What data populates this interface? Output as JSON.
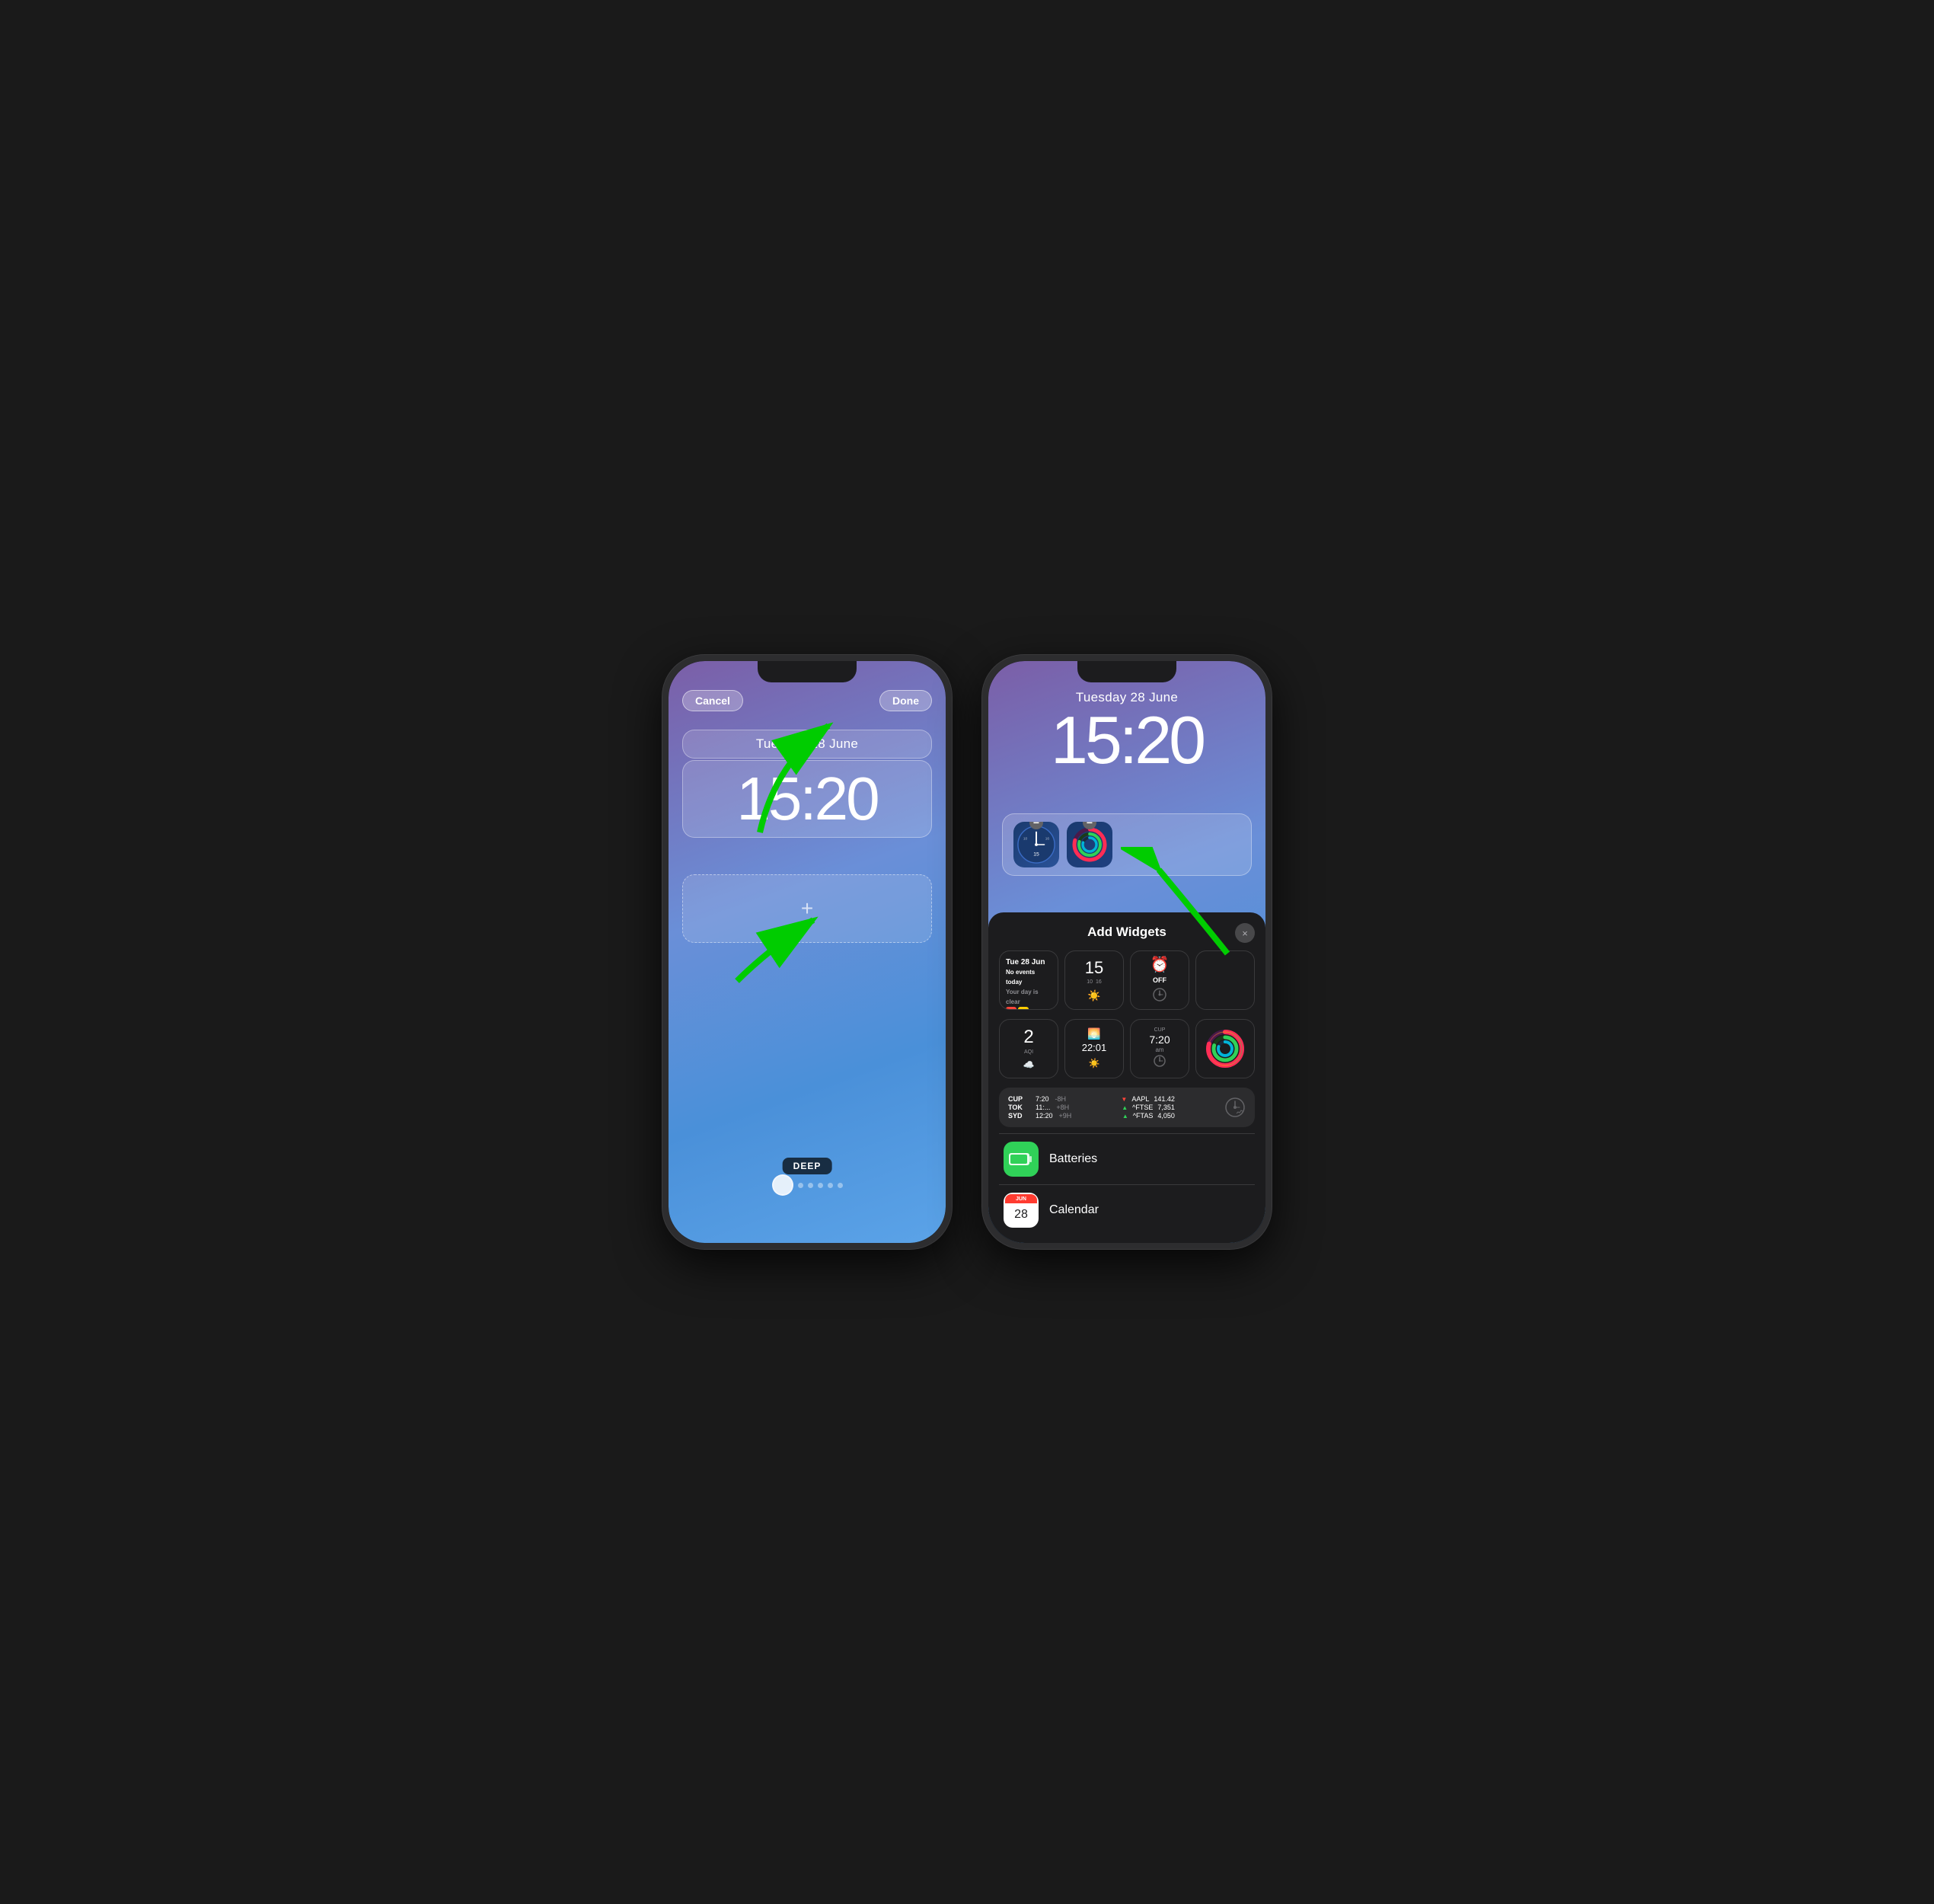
{
  "phone_left": {
    "cancel_label": "Cancel",
    "done_label": "Done",
    "date": "Tuesday 28 June",
    "time": "15:20",
    "add_widget_icon": "+",
    "wallpaper_label": "DEEP",
    "dots_count": 6
  },
  "phone_right": {
    "date": "Tuesday 28 June",
    "time": "15:20",
    "widget_clock_time": "15",
    "widget_clock_sub": "10  16",
    "panel": {
      "title": "Add Widgets",
      "close_icon": "×",
      "widgets_row1": [
        {
          "type": "calendar",
          "date": "Tue 28 Jun",
          "line1": "No events today",
          "line2": "Your day is clear"
        },
        {
          "type": "worldclock",
          "time": "15",
          "sub": "10  16"
        },
        {
          "type": "alarm",
          "label": "OFF"
        }
      ],
      "widgets_row2": [
        {
          "type": "aqi",
          "value": "2",
          "label": "AQI"
        },
        {
          "type": "sunrise",
          "time": "22:01"
        },
        {
          "type": "cup",
          "label": "CUP",
          "time": "7:20",
          "ampm": "am"
        },
        {
          "type": "activity"
        }
      ],
      "worldclock_row": {
        "cities": [
          {
            "code": "CUP",
            "time": "7:20",
            "offset": "-8H"
          },
          {
            "code": "TOK",
            "time": "11:...",
            "offset": "+8H"
          },
          {
            "code": "SYD",
            "time": "12:20",
            "offset": "+9H"
          }
        ],
        "stocks": [
          {
            "arrow": "down",
            "sym": "AAPL",
            "val": "141.42"
          },
          {
            "arrow": "up",
            "sym": "^FTSE",
            "val": "7,351"
          },
          {
            "arrow": "up",
            "sym": "^FTAS",
            "val": "4,050"
          }
        ]
      },
      "app_rows": [
        {
          "name": "Batteries",
          "icon_type": "batteries"
        },
        {
          "name": "Calendar",
          "icon_type": "calendar"
        }
      ]
    }
  }
}
